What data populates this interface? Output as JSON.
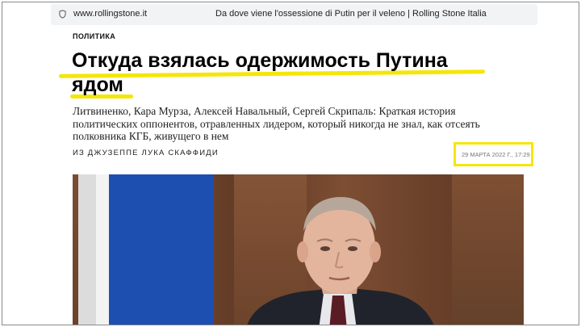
{
  "browser": {
    "url": "www.rollingstone.it",
    "tab_title": "Da dove viene l'ossessione di Putin per il veleno | Rolling Stone Italia"
  },
  "article": {
    "category": "ПОЛИТИКА",
    "headline_line1": "Откуда взялась одержимость Путина",
    "headline_line2": "ядом",
    "dek": "Литвиненко, Кара Мурза, Алексей Навальный, Сергей Скрипаль: Краткая история политических оппонентов, отравленных лидером, который никогда не знал, как отсеять полковника КГБ, живущего в нем",
    "author": "ИЗ ДЖУЗЕППЕ ЛУКА СКАФФИДИ",
    "date": "29 МАРТА 2022 Г., 17:29"
  },
  "colors": {
    "highlight": "#f5e60a",
    "flag_blue": "#1d4fb0"
  }
}
